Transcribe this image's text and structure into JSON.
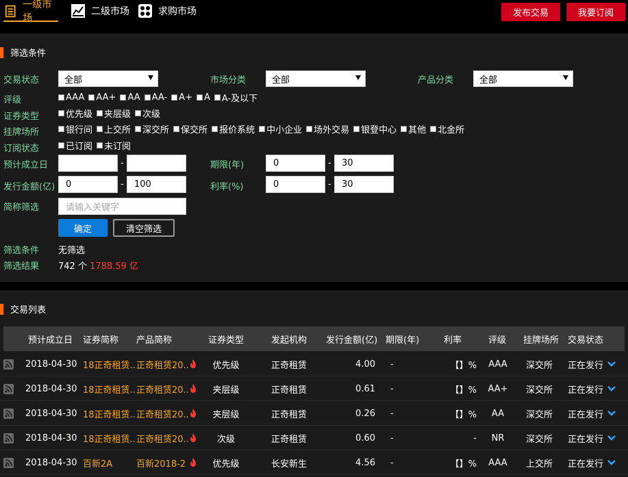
{
  "topnav": {
    "tabs": [
      {
        "label": "一级市场",
        "active": true,
        "icon": "document-icon"
      },
      {
        "label": "二级市场",
        "active": false,
        "icon": "chart-icon"
      },
      {
        "label": "求购市场",
        "active": false,
        "icon": "grid-icon"
      }
    ],
    "publish_label": "发布交易",
    "subscribe_label": "我要订阅"
  },
  "filters": {
    "title": "筛选条件",
    "trade_status_label": "交易状态",
    "trade_status_value": "全部",
    "market_category_label": "市场分类",
    "market_category_value": "全部",
    "product_category_label": "产品分类",
    "product_category_value": "全部",
    "rating_label": "评级",
    "ratings": [
      "AAA",
      "AA+",
      "AA",
      "AA-",
      "A+",
      "A",
      "A-及以下"
    ],
    "security_type_label": "证券类型",
    "security_types": [
      "优先级",
      "夹层级",
      "次级"
    ],
    "venue_label": "挂牌场所",
    "venues": [
      "银行间",
      "上交所",
      "深交所",
      "保交所",
      "报价系统",
      "中小企业",
      "场外交易",
      "银登中心",
      "其他",
      "北金所"
    ],
    "subscription_label": "订阅状态",
    "subscriptions": [
      "已订阅",
      "未订阅"
    ],
    "expected_date_label": "预计成立日",
    "expected_date_from": "",
    "expected_date_to": "",
    "term_label": "期限(年)",
    "term_from": "0",
    "term_to": "30",
    "amount_label": "发行金额(亿)",
    "amount_from": "0",
    "amount_to": "100",
    "rate_label": "利率(%)",
    "rate_from": "0",
    "rate_to": "30",
    "name_filter_label": "简称筛选",
    "name_filter_placeholder": "请输入关键字",
    "confirm_label": "确定",
    "clear_label": "清空筛选",
    "conditions_label": "筛选条件",
    "conditions_value": "无筛选",
    "result_label": "筛选结果",
    "result_count": "742 个",
    "result_amount": "1788.59 亿",
    "dash": "-"
  },
  "table": {
    "title": "交易列表",
    "headers": [
      "预计成立日",
      "证券简称",
      "产品简称",
      "证券类型",
      "发起机构",
      "发行金额(亿)",
      "期限(年)",
      "利率",
      "评级",
      "挂牌场所",
      "交易状态"
    ],
    "rows": [
      {
        "date": "2018-04-30",
        "security": "18正奇租赁...",
        "product": "正奇租赁20...",
        "type": "优先级",
        "issuer": "正奇租赁",
        "amount": "4.00",
        "term": "-",
        "rate": "【】%",
        "rating": "AAA",
        "venue": "深交所",
        "status": "正在发行"
      },
      {
        "date": "2018-04-30",
        "security": "18正奇租赁...",
        "product": "正奇租赁20...",
        "type": "夹层级",
        "issuer": "正奇租赁",
        "amount": "0.61",
        "term": "-",
        "rate": "【】%",
        "rating": "AA+",
        "venue": "深交所",
        "status": "正在发行"
      },
      {
        "date": "2018-04-30",
        "security": "18正奇租赁...",
        "product": "正奇租赁20...",
        "type": "夹层级",
        "issuer": "正奇租赁",
        "amount": "0.26",
        "term": "-",
        "rate": "【】%",
        "rating": "AA",
        "venue": "深交所",
        "status": "正在发行"
      },
      {
        "date": "2018-04-30",
        "security": "18正奇租赁...",
        "product": "正奇租赁20...",
        "type": "次级",
        "issuer": "正奇租赁",
        "amount": "0.60",
        "term": "-",
        "rate": "-",
        "rating": "NR",
        "venue": "深交所",
        "status": "正在发行"
      },
      {
        "date": "2018-04-30",
        "security": "百新2A",
        "product": "百新2018-2",
        "type": "优先级",
        "issuer": "长安新生",
        "amount": "4.56",
        "term": "-",
        "rate": "【】%",
        "rating": "AAA",
        "venue": "上交所",
        "status": "正在发行"
      }
    ]
  },
  "colors": {
    "accent": "#f5a623",
    "red": "#d0021b",
    "blue": "#0a7bd8",
    "label_green": "#7ed6a0",
    "result_red": "#ff3b30"
  }
}
